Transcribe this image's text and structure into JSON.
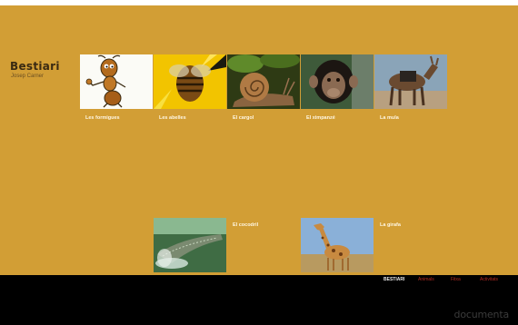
{
  "site": {
    "title": "Bestiari",
    "subtitle": "Josep Carner"
  },
  "gallery": {
    "row1": [
      {
        "caption": "Les formigues",
        "icon": "ant-cartoon-image"
      },
      {
        "caption": "Les abelles",
        "icon": "bee-image"
      },
      {
        "caption": "El cargol",
        "icon": "snail-image"
      },
      {
        "caption": "El ximpanzé",
        "icon": "chimpanzee-image"
      },
      {
        "caption": "La mula",
        "icon": "mule-image"
      }
    ],
    "row2": [
      {
        "caption": "El cocodril",
        "icon": "crocodile-image"
      },
      {
        "caption": "La girafa",
        "icon": "giraffe-image"
      }
    ]
  },
  "footer": {
    "nav": [
      "BESTIARI",
      "Animals",
      "Fitxa",
      "Activitats"
    ],
    "watermark": "documenta"
  },
  "colors": {
    "background": "#d29e35",
    "footer": "#000000",
    "accent": "#b02a22"
  }
}
